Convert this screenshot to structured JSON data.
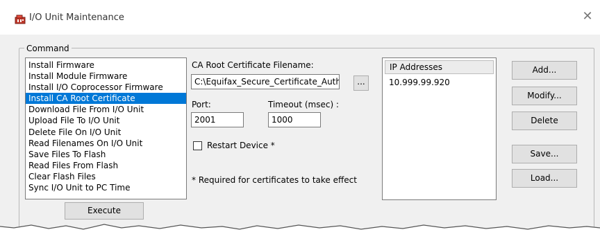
{
  "window": {
    "title": "I/O Unit Maintenance",
    "icon": "io-unit-icon",
    "close_symbol": "✕"
  },
  "command_group": {
    "label": "Command"
  },
  "commands": [
    "Install Firmware",
    "Install Module Firmware",
    "Install I/O Coprocessor Firmware",
    "Install CA Root Certificate",
    "Download File From I/O Unit",
    "Upload File To I/O Unit",
    "Delete File On I/O Unit",
    "Read Filenames On I/O Unit",
    "Save Files To Flash",
    "Read Files From Flash",
    "Clear Flash Files",
    "Sync I/O Unit to PC Time"
  ],
  "selected_command": "Install CA Root Certificate",
  "execute_label": "Execute",
  "ca_root": {
    "label": "CA Root Certificate Filename:",
    "value": "C:\\Equifax_Secure_Certificate_Authority.pem",
    "browse_label": "..."
  },
  "port": {
    "label": "Port:",
    "value": "2001"
  },
  "timeout": {
    "label": "Timeout (msec) :",
    "value": "1000"
  },
  "restart": {
    "label": "Restart Device *",
    "checked": false
  },
  "note": "* Required for certificates to take effect",
  "ip_list": {
    "header": "IP Addresses",
    "items": [
      "10.999.99.920"
    ]
  },
  "buttons": {
    "add": "Add...",
    "modify": "Modify...",
    "delete": "Delete",
    "save": "Save...",
    "load": "Load..."
  },
  "colors": {
    "selection": "#0078d7",
    "dialog_bg": "#f0f0f0"
  }
}
